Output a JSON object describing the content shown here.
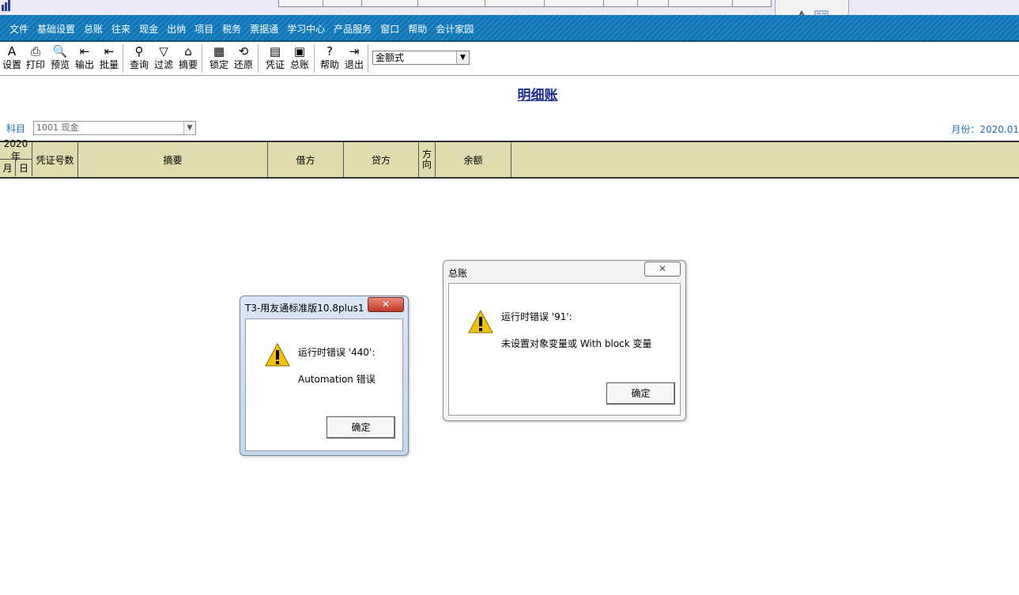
{
  "menu": [
    "文件",
    "基础设置",
    "总账",
    "往来",
    "现金",
    "出纳",
    "项目",
    "税务",
    "票据通",
    "学习中心",
    "产品服务",
    "窗口",
    "帮助",
    "会计家园"
  ],
  "toolbar": {
    "buttons": [
      {
        "id": "settings",
        "label": "设置",
        "icon": "A"
      },
      {
        "id": "print",
        "label": "打印",
        "icon": "⎙"
      },
      {
        "id": "preview",
        "label": "预览",
        "icon": "🔍"
      },
      {
        "id": "export",
        "label": "输出",
        "icon": "⇤"
      },
      {
        "id": "batch",
        "label": "批量",
        "icon": "⇤"
      },
      {
        "id": "query",
        "label": "查询",
        "icon": "⚲"
      },
      {
        "id": "filter",
        "label": "过滤",
        "icon": "▽"
      },
      {
        "id": "summary",
        "label": "摘要",
        "icon": "⌂"
      },
      {
        "id": "lock",
        "label": "锁定",
        "icon": "▦"
      },
      {
        "id": "restore",
        "label": "还原",
        "icon": "⟲"
      },
      {
        "id": "voucher",
        "label": "凭证",
        "icon": "▤"
      },
      {
        "id": "ledger",
        "label": "总账",
        "icon": "▣"
      },
      {
        "id": "help",
        "label": "帮助",
        "icon": "?"
      },
      {
        "id": "exit",
        "label": "退出",
        "icon": "⇥"
      }
    ],
    "format_select": "金额式"
  },
  "report": {
    "title": "明细账",
    "subject_label": "科目",
    "subject_value": "1001 现金",
    "period": "月份：2020.01"
  },
  "grid": {
    "year": "2020年",
    "month": "月",
    "day": "日",
    "voucher_no": "凭证号数",
    "summary": "摘要",
    "debit": "借方",
    "credit": "贷方",
    "direction": "方向",
    "balance": "余额"
  },
  "dialog_t3": {
    "title": "T3-用友通标准版10.8plus1",
    "close": "✕",
    "line1": "运行时错误 '440':",
    "line2": "Automation 错误",
    "ok": "确定"
  },
  "dialog_gl": {
    "title": "总账",
    "close": "✕",
    "line1": "运行时错误 '91':",
    "line2": "未设置对象变量或 With block 变量",
    "ok": "确定"
  },
  "colors": {
    "menubar": "#1a84c4",
    "grid_header": "#e0dcb0",
    "title": "#1a2c8e",
    "label_blue": "#1f6fb2",
    "warning": "#f2c200"
  }
}
